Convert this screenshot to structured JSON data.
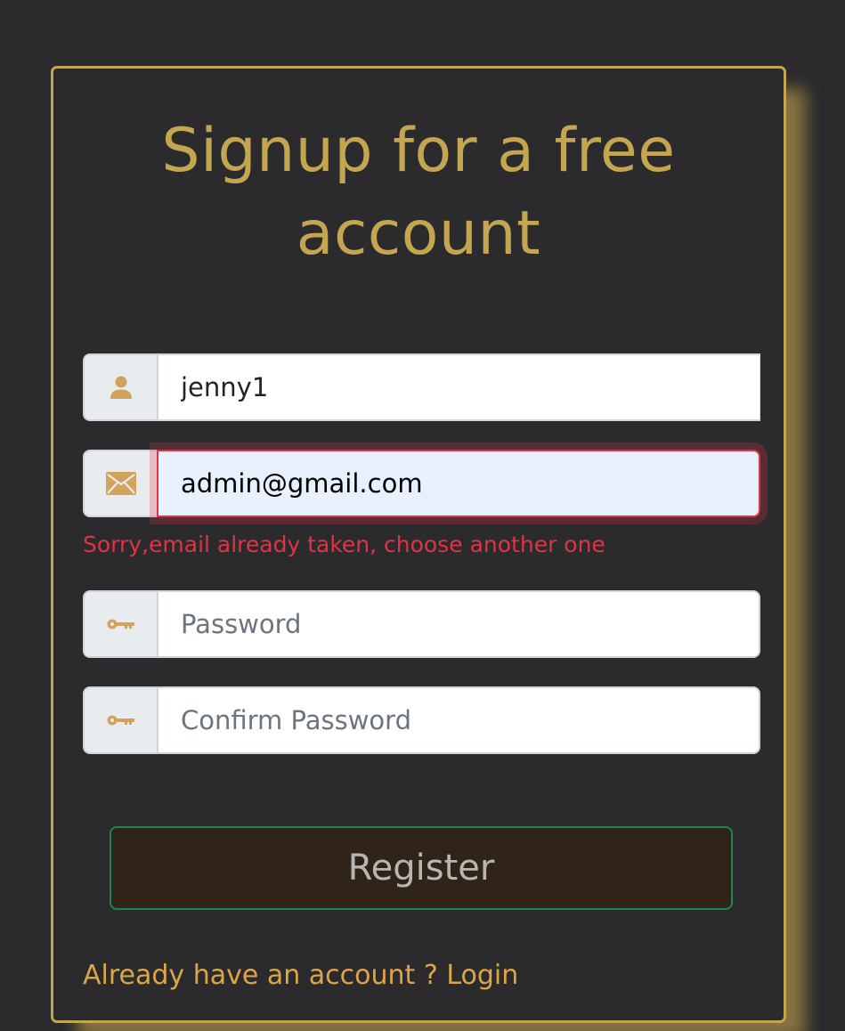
{
  "form": {
    "title": "Signup for a free account",
    "username": {
      "icon": "user-icon",
      "value": "jenny1"
    },
    "email": {
      "icon": "envelope-icon",
      "value": "admin@gmail.com",
      "error": "Sorry,email already taken, choose another one"
    },
    "password": {
      "icon": "key-icon",
      "value": "",
      "placeholder": "Password"
    },
    "confirm_password": {
      "icon": "key-icon",
      "value": "",
      "placeholder": "Confirm Password"
    },
    "register_label": "Register",
    "login_prompt": "Already have an account ?",
    "login_link": "Login"
  },
  "colors": {
    "background": "#2b2a2c",
    "accent": "#c4a550",
    "icon": "#d2a45b",
    "error": "#dc3545",
    "link": "#dca548",
    "button_bg": "#302418",
    "button_border": "#198754"
  }
}
